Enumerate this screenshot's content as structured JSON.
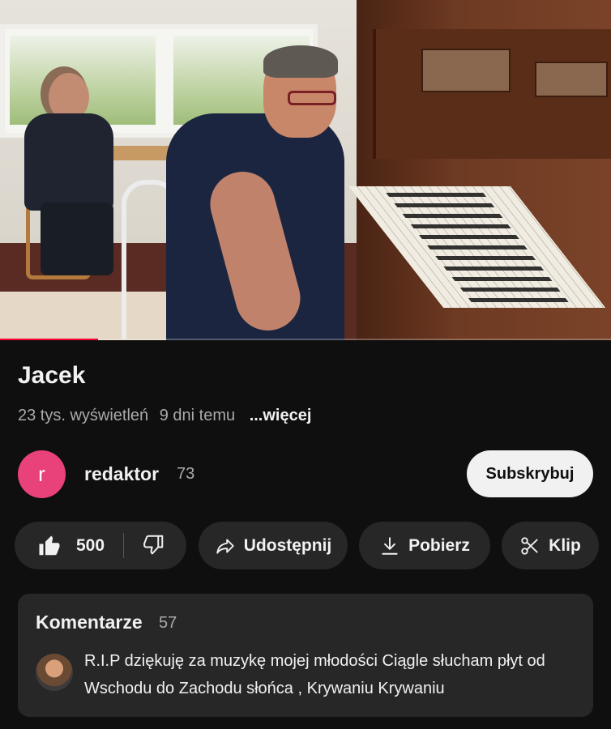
{
  "video": {
    "progress_fraction": 0.16
  },
  "info": {
    "title": "Jacek",
    "views": "23 tys. wyświetleń",
    "age": "9 dni temu",
    "more": "...więcej"
  },
  "channel": {
    "avatar_letter": "r",
    "avatar_color": "#e9417a",
    "name": "redaktor",
    "subscribers": "73",
    "subscribe_label": "Subskrybuj"
  },
  "actions": {
    "like_count": "500",
    "share_label": "Udostępnij",
    "download_label": "Pobierz",
    "clip_label": "Klip"
  },
  "comments": {
    "header": "Komentarze",
    "count": "57",
    "top_comment": "R.I.P dziękuję za muzykę mojej młodości Ciągle słucham płyt od Wschodu do Zachodu słońca , Krywaniu Krywaniu"
  },
  "colors": {
    "background": "#0f0f0f",
    "pill": "#272727",
    "progress": "#ff0033"
  }
}
